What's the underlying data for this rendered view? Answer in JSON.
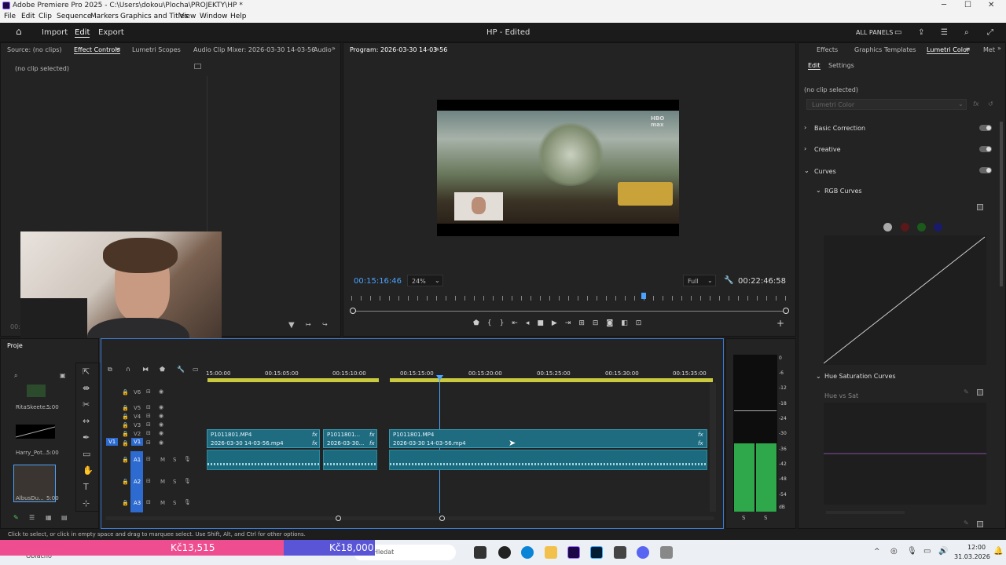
{
  "window": {
    "title": "Adobe Premiere Pro 2025 - C:\\Users\\dokou\\Plocha\\PROJEKTY\\HP *",
    "minimize": "─",
    "maximize": "☐",
    "close": "✕"
  },
  "menu": [
    "File",
    "Edit",
    "Clip",
    "Sequence",
    "Markers",
    "Graphics and Titles",
    "View",
    "Window",
    "Help"
  ],
  "appbar": {
    "import": "Import",
    "edit": "Edit",
    "export": "Export",
    "project_title": "HP - Edited",
    "all_panels": "ALL PANELS"
  },
  "source_panel": {
    "tabs": [
      "Source: (no clips)",
      "Effect Controls",
      "Lumetri Scopes",
      "Audio Clip Mixer: 2026-03-30 14-03-56",
      "Audio"
    ],
    "no_clip": "(no clip selected)",
    "time": "00:"
  },
  "program": {
    "tab": "Program: 2026-03-30 14-03-56",
    "timecode": "00:15:16:46",
    "zoom": "24%",
    "quality": "Full",
    "duration": "00:22:46:58",
    "watermark": "HBO max",
    "playhead_fraction": 0.67
  },
  "lumetri": {
    "tabs": [
      "Effects",
      "Graphics Templates",
      "Lumetri Color",
      "Met"
    ],
    "subtabs": [
      "Edit",
      "Settings"
    ],
    "no_clip": "(no clip selected)",
    "dropdown": "Lumetri Color",
    "sections": [
      "Basic Correction",
      "Creative",
      "Curves"
    ],
    "rgb_curves": "RGB Curves",
    "hue_sat": "Hue Saturation Curves",
    "hue_vs_sat": "Hue vs Sat"
  },
  "project": {
    "tab": "Proje",
    "items": [
      {
        "name": "RitaSkeete...",
        "duration": "5:00"
      },
      {
        "name": "Harry_Pot...",
        "duration": "5:00"
      },
      {
        "name": "AlbusDu...",
        "duration": "5:00"
      }
    ]
  },
  "timeline": {
    "ruler": [
      "15:00:00",
      "00:15:05:00",
      "00:15:10:00",
      "00:15:15:00",
      "00:15:20:00",
      "00:15:25:00",
      "00:15:30:00",
      "00:15:35:00"
    ],
    "video_tracks": [
      "V6",
      "V5",
      "V4",
      "V3",
      "V2",
      "V1"
    ],
    "audio_tracks": [
      "A1",
      "A2",
      "A3"
    ],
    "source_patch": "V1",
    "m": "M",
    "s": "S",
    "clips": [
      {
        "name": "P1011801.MP4",
        "sub": "2026-03-30 14-03-56.mp4"
      },
      {
        "name": "P1011801...",
        "sub": "2026-03-30..."
      },
      {
        "name": "P1011801.MP4",
        "sub": "2026-03-30 14-03-56.mp4"
      }
    ],
    "fx": "fx"
  },
  "meter": {
    "labels": [
      "0",
      "-6",
      "-12",
      "-18",
      "-24",
      "-30",
      "-36",
      "-42",
      "-48",
      "-54",
      "dB"
    ],
    "solo": [
      "S",
      "S"
    ],
    "left_level": 0.75,
    "right_level": 0.75
  },
  "status": "Click to select, or click in empty space and drag to marquee select. Use Shift, Alt, and Ctrl for other options.",
  "overlay": {
    "left_amount": "Kč13,515",
    "right_amount": "Kč18,000",
    "weather": "Oblačno"
  },
  "taskbar": {
    "search": "Hledat",
    "time": "12:00",
    "date": "31.03.2026"
  },
  "colors": {
    "accent": "#4aa3ff",
    "clip": "#1f6b80",
    "meter": "#2ea84a",
    "pink": "#ee4d8f",
    "purple": "#5a55d6"
  }
}
